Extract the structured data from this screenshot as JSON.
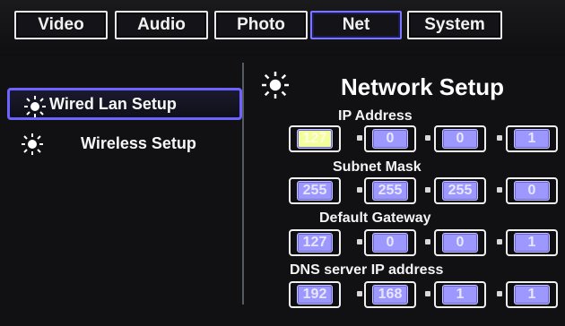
{
  "tabs": [
    {
      "label": "Video",
      "active": false
    },
    {
      "label": "Audio",
      "active": false
    },
    {
      "label": "Photo",
      "active": false
    },
    {
      "label": "Net",
      "active": true
    },
    {
      "label": "System",
      "active": false
    }
  ],
  "sidebar": {
    "items": [
      {
        "label": "Wired Lan Setup",
        "selected": true,
        "icon": "sun-icon"
      },
      {
        "label": "Wireless Setup",
        "selected": false,
        "icon": "sun-icon"
      }
    ]
  },
  "main": {
    "title": "Network Setup",
    "title_icon": "sun-icon",
    "sections": {
      "ip": {
        "label": "IP Address",
        "octets": [
          "127",
          "0",
          "0",
          "1"
        ]
      },
      "subnet": {
        "label": "Subnet Mask",
        "octets": [
          "255",
          "255",
          "255",
          "0"
        ]
      },
      "gateway": {
        "label": "Default Gateway",
        "octets": [
          "127",
          "0",
          "0",
          "1"
        ]
      },
      "dns": {
        "label": "DNS server IP address",
        "octets": [
          "192",
          "168",
          "1",
          "1"
        ]
      }
    }
  },
  "colors": {
    "accent": "#6d63ff",
    "field_fill": "#9c98ff",
    "focus_fill": "#f2ff9a"
  }
}
